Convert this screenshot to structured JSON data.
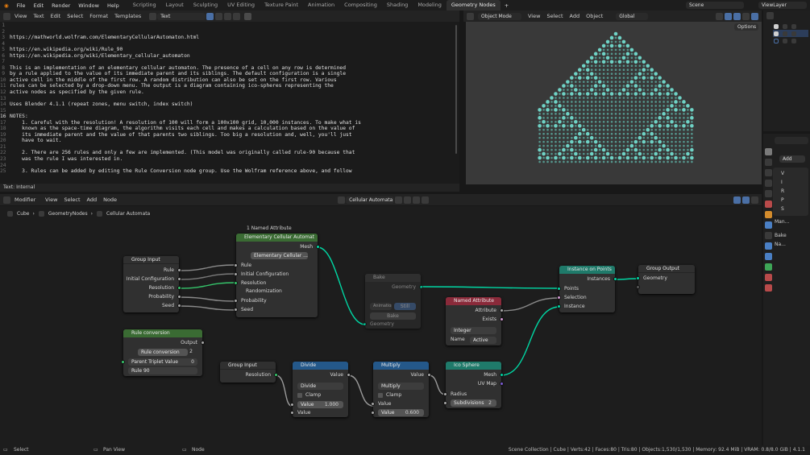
{
  "topbar": {
    "menus": [
      "File",
      "Edit",
      "Render",
      "Window",
      "Help"
    ],
    "workspaces": [
      "Layout",
      "Modeling",
      "Sculpting",
      "UV Editing",
      "Texture Paint",
      "Shading",
      "Animation",
      "Rendering",
      "Compositing",
      "Geometry Nodes",
      "Scripting"
    ],
    "scene": "Scene",
    "viewlayer": "ViewLayer"
  },
  "text_editor": {
    "menus": [
      "View",
      "Text",
      "Edit",
      "Select",
      "Format",
      "Templates"
    ],
    "filename": "Text",
    "footer": "Text: Internal",
    "lines": [
      {
        "n": "1",
        "t": ""
      },
      {
        "n": "2",
        "t": ""
      },
      {
        "n": "3",
        "t": "https://mathworld.wolfram.com/ElementaryCellularAutomaton.html"
      },
      {
        "n": "4",
        "t": ""
      },
      {
        "n": "5",
        "t": "https://en.wikipedia.org/wiki/Rule_90"
      },
      {
        "n": "6",
        "t": "https://en.wikipedia.org/wiki/Elementary_cellular_automaton"
      },
      {
        "n": "7",
        "t": ""
      },
      {
        "n": "8",
        "t": "This is an implementation of an elementary cellular automaton. The presence of a cell on any row is determined"
      },
      {
        "n": "9",
        "t": "by a rule applied to the value of its immediate parent and its siblings. The default configuration is a single"
      },
      {
        "n": "10",
        "t": "active cell in the middle of the first row. A random distribution can also be set on the first row. Various"
      },
      {
        "n": "11",
        "t": "rules can be selected by a drop-down menu. The output is a diagram containing ico-spheres representing the"
      },
      {
        "n": "12",
        "t": "active nodes as specified by the given rule."
      },
      {
        "n": "13",
        "t": ""
      },
      {
        "n": "14",
        "t": "Uses Blender 4.1.1 (repeat zones, menu switch, index switch)"
      },
      {
        "n": "15",
        "t": ""
      },
      {
        "n": "16",
        "t": "NOTES:"
      },
      {
        "n": "17",
        "t": "    1. Careful with the resolution! A resolution of 100 will form a 100x100 grid, 10,000 instances. To make what is"
      },
      {
        "n": "18",
        "t": "    known as the space-time diagram, the algorithm visits each cell and makes a calculation based on the value of"
      },
      {
        "n": "19",
        "t": "    its immediate parent and the value of that parents two siblings. Too big a resolution and, well, you'll just"
      },
      {
        "n": "20",
        "t": "    have to wait."
      },
      {
        "n": "21",
        "t": ""
      },
      {
        "n": "22",
        "t": "    2. There are 256 rules and only a few are implemented. (This model was originally called rule-90 because that"
      },
      {
        "n": "23",
        "t": "    was the rule I was interested in."
      },
      {
        "n": "24",
        "t": ""
      },
      {
        "n": "25",
        "t": "    3. Rules can be added by editing the Rule Conversion node group. Use the Wolfram reference above, and follow"
      }
    ]
  },
  "viewport": {
    "mode": "Object Mode",
    "menus": [
      "View",
      "Select",
      "Add",
      "Object"
    ],
    "orientation": "Global",
    "options": "Options",
    "diagram_color": "#6fd3c6"
  },
  "node_editor": {
    "editor_type": "Modifier",
    "menus": [
      "View",
      "Select",
      "Add",
      "Node"
    ],
    "tree_name": "Cellular Automata",
    "breadcrumb": [
      "Cube",
      "GeometryNodes",
      "Cellular Automata"
    ]
  },
  "nodes": {
    "group_input_1": {
      "title": "Group Input",
      "outs": [
        "Rule",
        "Initial Configuration",
        "Resolution",
        "Probability",
        "Seed"
      ]
    },
    "eca": {
      "label": "1 Named Attribute",
      "title": "Elementary Cellular Automat",
      "out": "Mesh",
      "group": "Elementary Cellular ...",
      "ins": [
        "Rule",
        "Initial Configuration",
        "Resolution"
      ],
      "panel": "Randomization",
      "panel_ins": [
        "Probability",
        "Seed"
      ]
    },
    "bake": {
      "title": "Bake",
      "out": "Geometry",
      "animation": "Animation",
      "still": "Still",
      "bake_btn": "Bake",
      "in": "Geometry"
    },
    "instance_on_points": {
      "title": "Instance on Points",
      "out": "Instances",
      "ins": [
        "Points",
        "Selection",
        "Instance"
      ]
    },
    "group_output": {
      "title": "Group Output",
      "in": "Geometry"
    },
    "named_attribute": {
      "title": "Named Attribute",
      "outs": [
        "Attribute",
        "Exists"
      ],
      "type": "Integer",
      "name_label": "Name",
      "name_value": "Active"
    },
    "rule_conversion": {
      "title": "Rule conversion",
      "out": "Output",
      "group": "Rule conversion",
      "users": "2",
      "parent_triplet_label": "Parent Triplet Value",
      "parent_triplet_value": "0",
      "rule": "Rule 90"
    },
    "group_input_2": {
      "title": "Group Input",
      "out": "Resolution"
    },
    "divide": {
      "title": "Divide",
      "out": "Value",
      "op": "Divide",
      "clamp": "Clamp",
      "value_label": "Value",
      "value_val": "1.000",
      "in": "Value"
    },
    "multiply": {
      "title": "Multiply",
      "out": "Value",
      "op": "Multiply",
      "clamp": "Clamp",
      "in": "Value",
      "value_label": "Value",
      "value_val": "0.600"
    },
    "ico_sphere": {
      "title": "Ico Sphere",
      "outs": [
        "Mesh",
        "UV Map"
      ],
      "in": "Radius",
      "sub_label": "Subdivisions",
      "sub_val": "2"
    }
  },
  "properties": {
    "labels": [
      "Add",
      "Bake",
      "Na...",
      "Man..."
    ],
    "rows": [
      "V",
      "I",
      "R",
      "P",
      "S"
    ]
  },
  "statusbar": {
    "left": [
      "Select",
      "Pan View",
      "Node"
    ],
    "right": "Scene Collection | Cube | Verts:42 | Faces:80 | Tris:80 | Objects:1,530/1,530 | Memory: 92.4 MiB | VRAM: 0.8/8.0 GiB | 4.1.1"
  }
}
